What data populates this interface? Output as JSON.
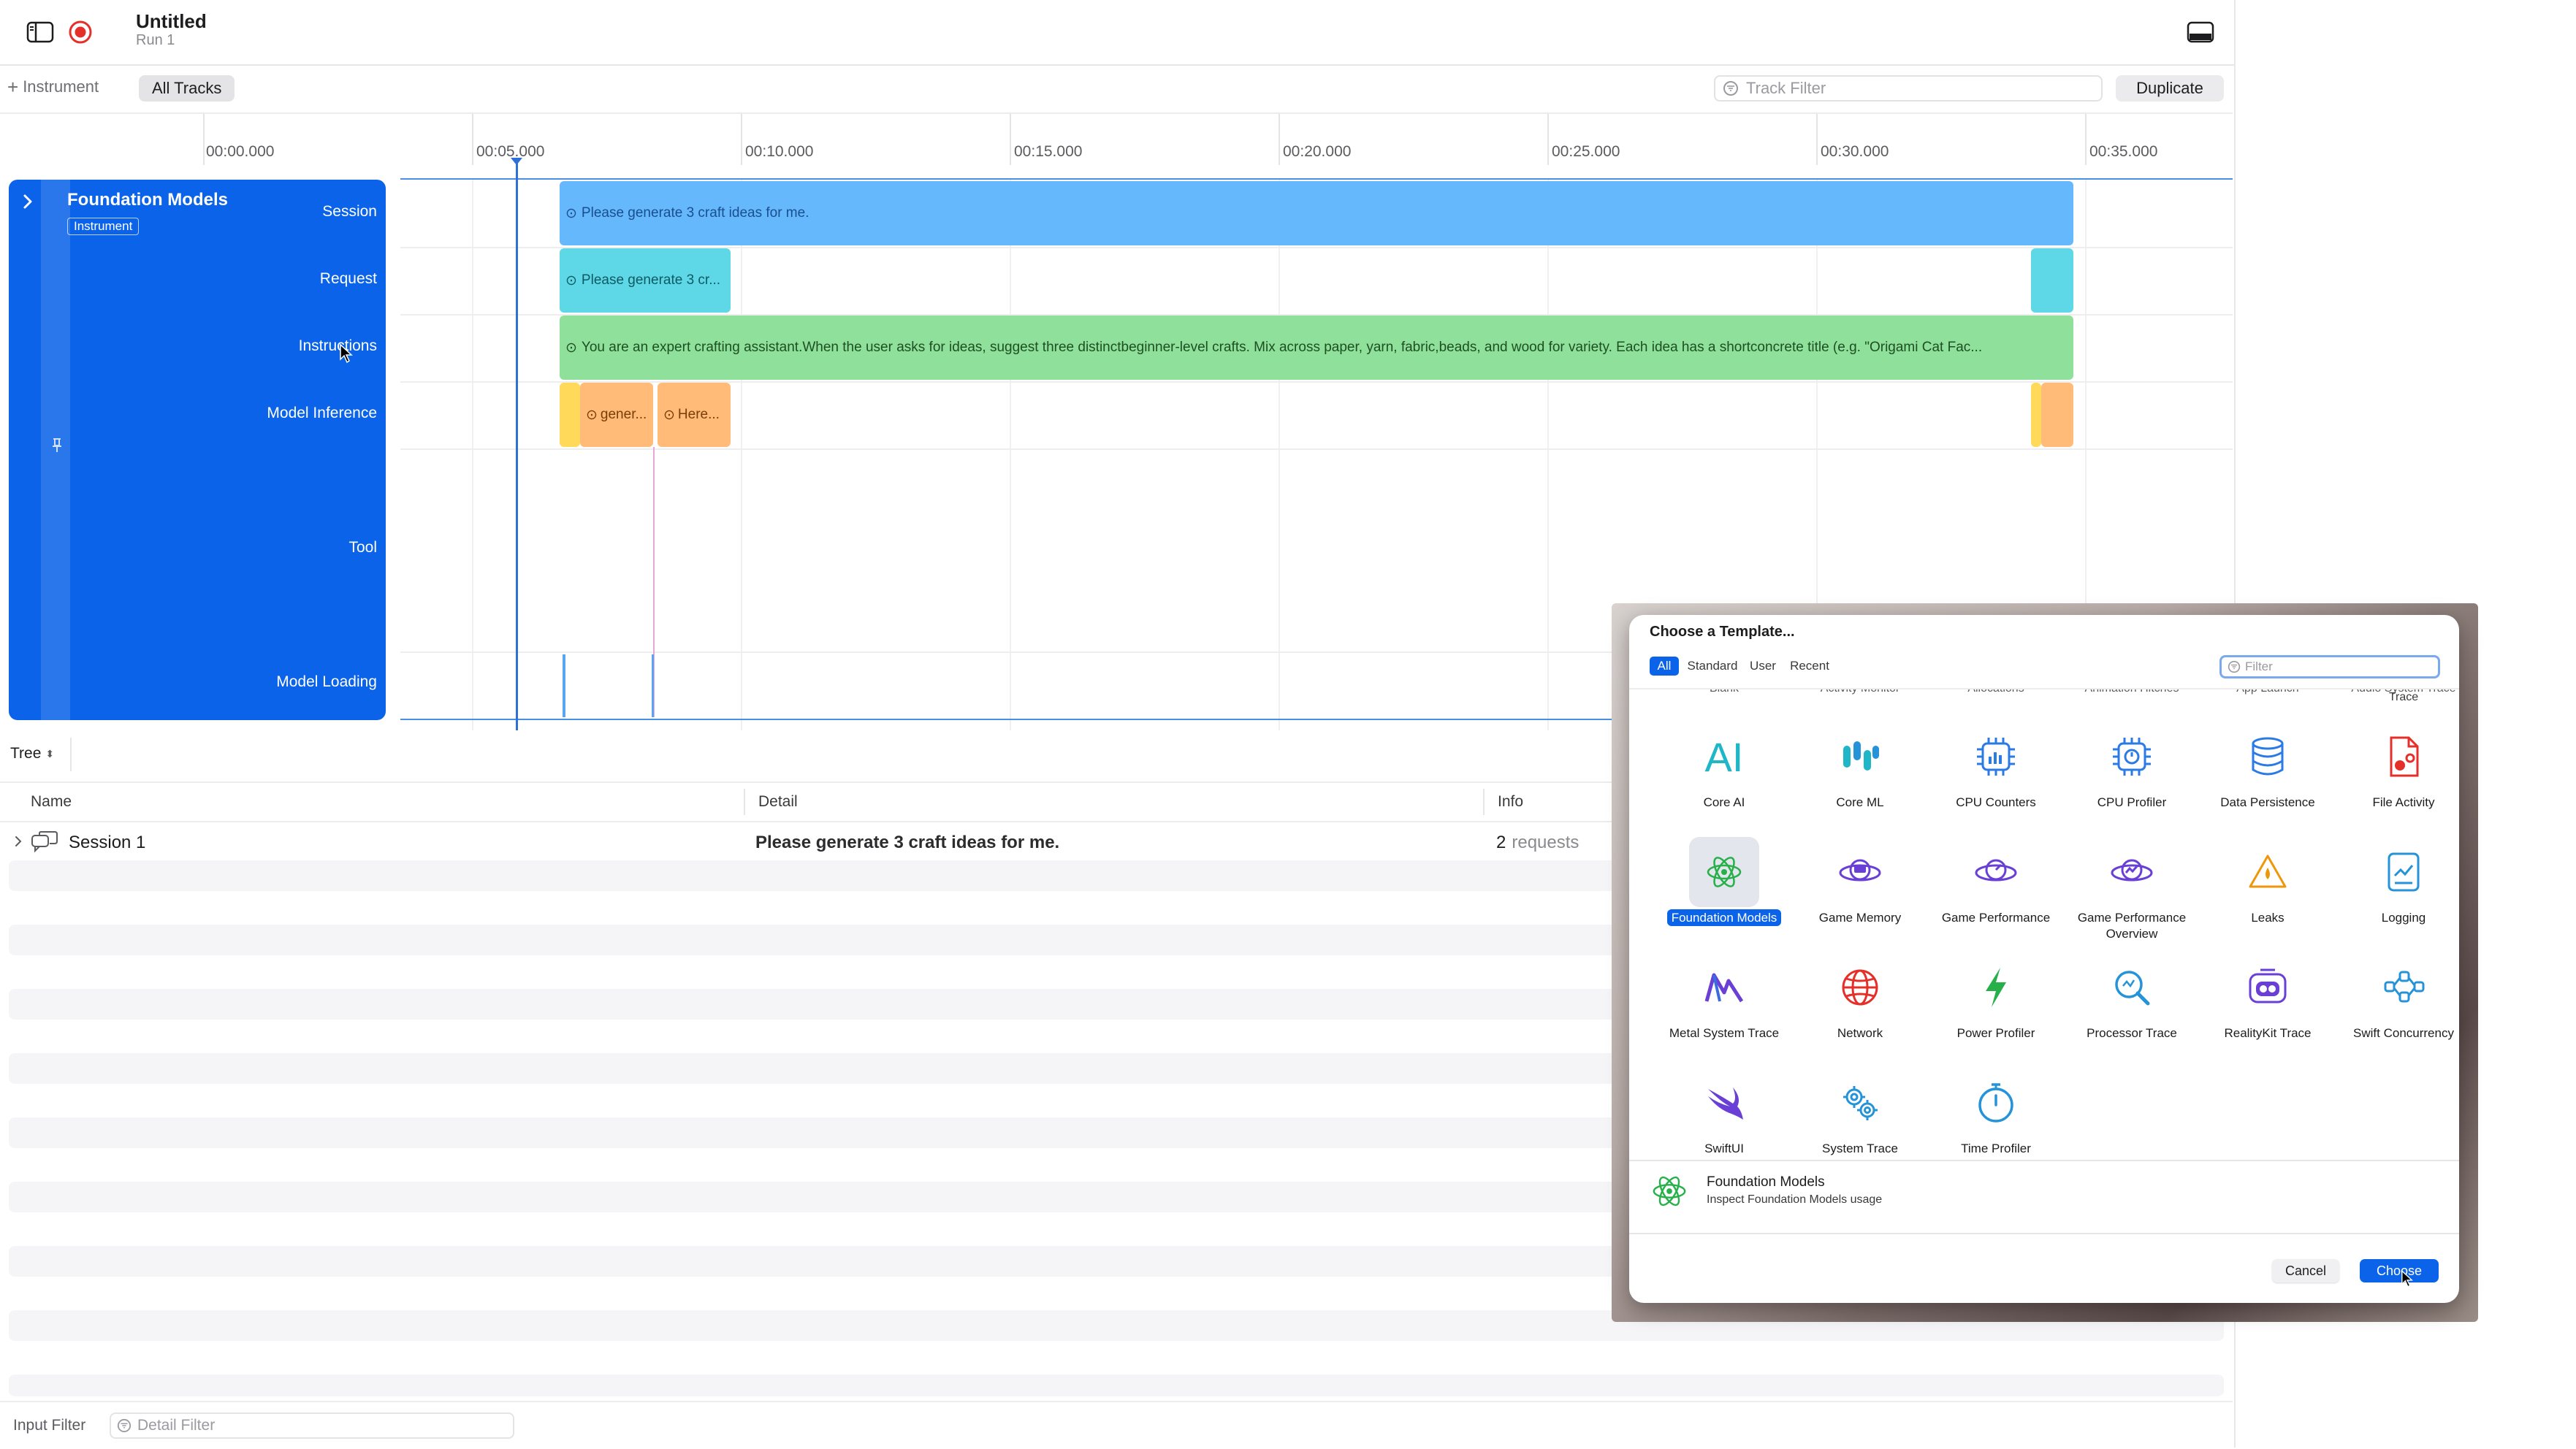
{
  "window": {
    "title": "Untitled",
    "subtitle": "Run 1"
  },
  "toolbar": {
    "add_instrument": "Instrument",
    "all_tracks": "All Tracks",
    "track_filter_placeholder": "Track Filter",
    "duplicate": "Duplicate"
  },
  "ruler": {
    "ticks": [
      "00:00.000",
      "00:05.000",
      "00:10.000",
      "00:15.000",
      "00:20.000",
      "00:25.000",
      "00:30.000",
      "00:35.000"
    ]
  },
  "instrument": {
    "name": "Foundation Models",
    "badge": "Instrument",
    "rows": [
      "Session",
      "Request",
      "Instructions",
      "Model Inference",
      "Tool",
      "Model Loading"
    ]
  },
  "tracks": {
    "session_text": "Please generate 3 craft ideas for me.",
    "request_text": "Please generate 3 cr...",
    "instructions_text": "You are an expert crafting assistant.When the user asks for ideas, suggest three distinctbeginner-level crafts. Mix across paper, yarn, fabric,beads, and wood for variety. Each idea has a shortconcrete title (e.g. \"Origami Cat Fac...",
    "inference_1": "gener...",
    "inference_2": "Here..."
  },
  "detail": {
    "view_mode": "Tree",
    "columns": [
      "Name",
      "Detail",
      "Info"
    ],
    "rows": [
      {
        "name": "Session 1",
        "detail": "Please generate 3 craft ideas for me.",
        "info_count": "2",
        "info_unit": "requests"
      }
    ]
  },
  "bottom_bar": {
    "input_filter": "Input Filter",
    "detail_filter_placeholder": "Detail Filter"
  },
  "dialog": {
    "title": "Choose a Template...",
    "tabs": [
      "All",
      "Standard",
      "User",
      "Recent"
    ],
    "filter_placeholder": "Filter",
    "cut_labels": [
      "Blank",
      "Activity Monitor",
      "Allocations",
      "Animation Hitches",
      "App Launch",
      "Audio System Trace"
    ],
    "templates": [
      {
        "label": "Core AI",
        "icon": "core-ai-icon"
      },
      {
        "label": "Core ML",
        "icon": "core-ml-icon"
      },
      {
        "label": "CPU Counters",
        "icon": "cpu-counters-icon"
      },
      {
        "label": "CPU Profiler",
        "icon": "cpu-profiler-icon"
      },
      {
        "label": "Data Persistence",
        "icon": "data-persistence-icon"
      },
      {
        "label": "File Activity",
        "icon": "file-activity-icon"
      },
      {
        "label": "Foundation Models",
        "icon": "foundation-models-icon"
      },
      {
        "label": "Game Memory",
        "icon": "game-memory-icon"
      },
      {
        "label": "Game Performance",
        "icon": "game-performance-icon"
      },
      {
        "label": "Game Performance Overview",
        "icon": "game-performance-overview-icon"
      },
      {
        "label": "Leaks",
        "icon": "leaks-icon"
      },
      {
        "label": "Logging",
        "icon": "logging-icon"
      },
      {
        "label": "Metal System Trace",
        "icon": "metal-icon"
      },
      {
        "label": "Network",
        "icon": "network-icon"
      },
      {
        "label": "Power Profiler",
        "icon": "power-profiler-icon"
      },
      {
        "label": "Processor Trace",
        "icon": "processor-trace-icon"
      },
      {
        "label": "RealityKit Trace",
        "icon": "realitykit-icon"
      },
      {
        "label": "Swift Concurrency",
        "icon": "swift-concurrency-icon"
      },
      {
        "label": "SwiftUI",
        "icon": "swiftui-icon"
      },
      {
        "label": "System Trace",
        "icon": "system-trace-icon"
      },
      {
        "label": "Time Profiler",
        "icon": "time-profiler-icon"
      }
    ],
    "selected": {
      "name": "Foundation Models",
      "description": "Inspect Foundation Models usage"
    },
    "cancel": "Cancel",
    "choose": "Choose"
  },
  "colors": {
    "accent": "#0a63e8",
    "session_bar": "#64b8fb",
    "request_bar": "#5ed8e6",
    "instructions_bar": "#8fe09b",
    "inference_bar": "#ffbb77",
    "inference_edge": "#ffd95a"
  }
}
